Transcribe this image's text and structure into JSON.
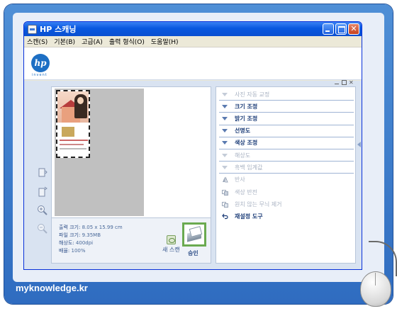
{
  "window": {
    "title": "HP 스캐닝"
  },
  "menu": [
    "스캔(S)",
    "기본(B)",
    "고급(A)",
    "출력 형식(O)",
    "도움말(H)"
  ],
  "logo": {
    "text": "hp",
    "tagline": "invent"
  },
  "left_tools": [
    "rotate-left-icon",
    "rotate-right-icon",
    "zoom-in-icon",
    "zoom-out-icon"
  ],
  "info": {
    "output_size_label": "출력 크기:",
    "output_size_value": "8.05 x 15.99 cm",
    "file_size_label": "파일 크기:",
    "file_size_value": "9.35MB",
    "resolution_label": "해상도:",
    "resolution_value": "400dpi",
    "scale_label": "배율:",
    "scale_value": "100%"
  },
  "buttons": {
    "new_scan": "새 스캔",
    "accept": "승인"
  },
  "tasks": [
    {
      "label": "사진 자동 교정",
      "enabled": false,
      "icon": "triangle"
    },
    {
      "label": "크기 조정",
      "enabled": true,
      "icon": "triangle"
    },
    {
      "label": "밝기 조정",
      "enabled": true,
      "icon": "triangle"
    },
    {
      "label": "선명도",
      "enabled": true,
      "icon": "triangle"
    },
    {
      "label": "색상 조정",
      "enabled": true,
      "icon": "triangle"
    },
    {
      "label": "해상도",
      "enabled": false,
      "icon": "triangle"
    },
    {
      "label": "흑백 임계값",
      "enabled": false,
      "icon": "triangle"
    },
    {
      "label": "반사",
      "enabled": false,
      "icon": "mirror-icon"
    },
    {
      "label": "색상 반전",
      "enabled": false,
      "icon": "invert-icon"
    },
    {
      "label": "원치 않는 무늬 제거",
      "enabled": false,
      "icon": "descreen-icon"
    },
    {
      "label": "재설정 도구",
      "enabled": true,
      "icon": "undo-icon"
    }
  ],
  "footer": {
    "watermark": "myknowledge.kr"
  },
  "colors": {
    "titlebar": "#0858e0",
    "accent": "#1c3d78",
    "frame": "#2f6cc0"
  }
}
